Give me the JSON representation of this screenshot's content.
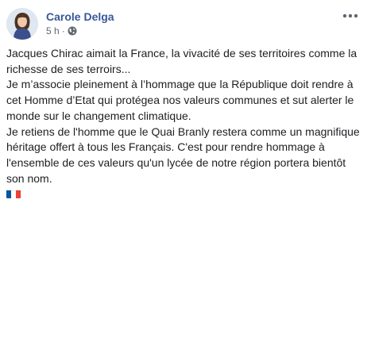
{
  "post": {
    "author": "Carole Delga",
    "timestamp": "5 h",
    "separator": "·",
    "privacy_icon": "globe-icon",
    "more_icon": "more-options-icon",
    "paragraphs": [
      "Jacques Chirac aimait la France, la vivacité de ses territoires comme la richesse de ses terroirs...",
      "Je m’associe pleinement à l’hommage que la République doit rendre à cet Homme d’Etat qui protégea nos valeurs communes et sut alerter le monde sur le changement climatique.",
      "Je retiens de l'homme que le Quai Branly restera comme un magnifique héritage offert à tous les Français. C'est pour rendre hommage à l'ensemble de ces valeurs qu'un lycée de notre région portera bientôt son nom."
    ],
    "emoji": "french-flag-icon"
  },
  "colors": {
    "author_link": "#385898",
    "text": "#1c1e21",
    "meta": "#606770",
    "flag_blue": "#0055A4",
    "flag_white": "#FFFFFF",
    "flag_red": "#EF4135"
  }
}
